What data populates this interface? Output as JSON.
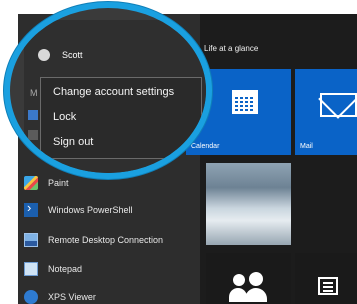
{
  "start_menu": {
    "section_title": "Life at a glance",
    "user": {
      "name": "Scott"
    },
    "letter_header": "M",
    "account_menu": [
      {
        "label": "Change account settings"
      },
      {
        "label": "Lock"
      },
      {
        "label": "Sign out"
      }
    ],
    "apps": [
      {
        "label": "Paint",
        "icon": "paint-icon"
      },
      {
        "label": "Windows PowerShell",
        "icon": "powershell-icon"
      },
      {
        "label": "Remote Desktop Connection",
        "icon": "remote-desktop-icon"
      },
      {
        "label": "Notepad",
        "icon": "notepad-icon"
      },
      {
        "label": "XPS Viewer",
        "icon": "xps-viewer-icon"
      }
    ],
    "tiles": [
      {
        "label": "Calendar",
        "icon": "calendar-icon"
      },
      {
        "label": "Mail",
        "icon": "mail-icon"
      },
      {
        "label": "",
        "icon": "photos-tile"
      },
      {
        "label": "",
        "icon": "people-icon"
      },
      {
        "label": "",
        "icon": "news-icon"
      }
    ]
  },
  "colors": {
    "accent": "#0a63c7",
    "magnifier_ring": "#1aa0e0"
  }
}
